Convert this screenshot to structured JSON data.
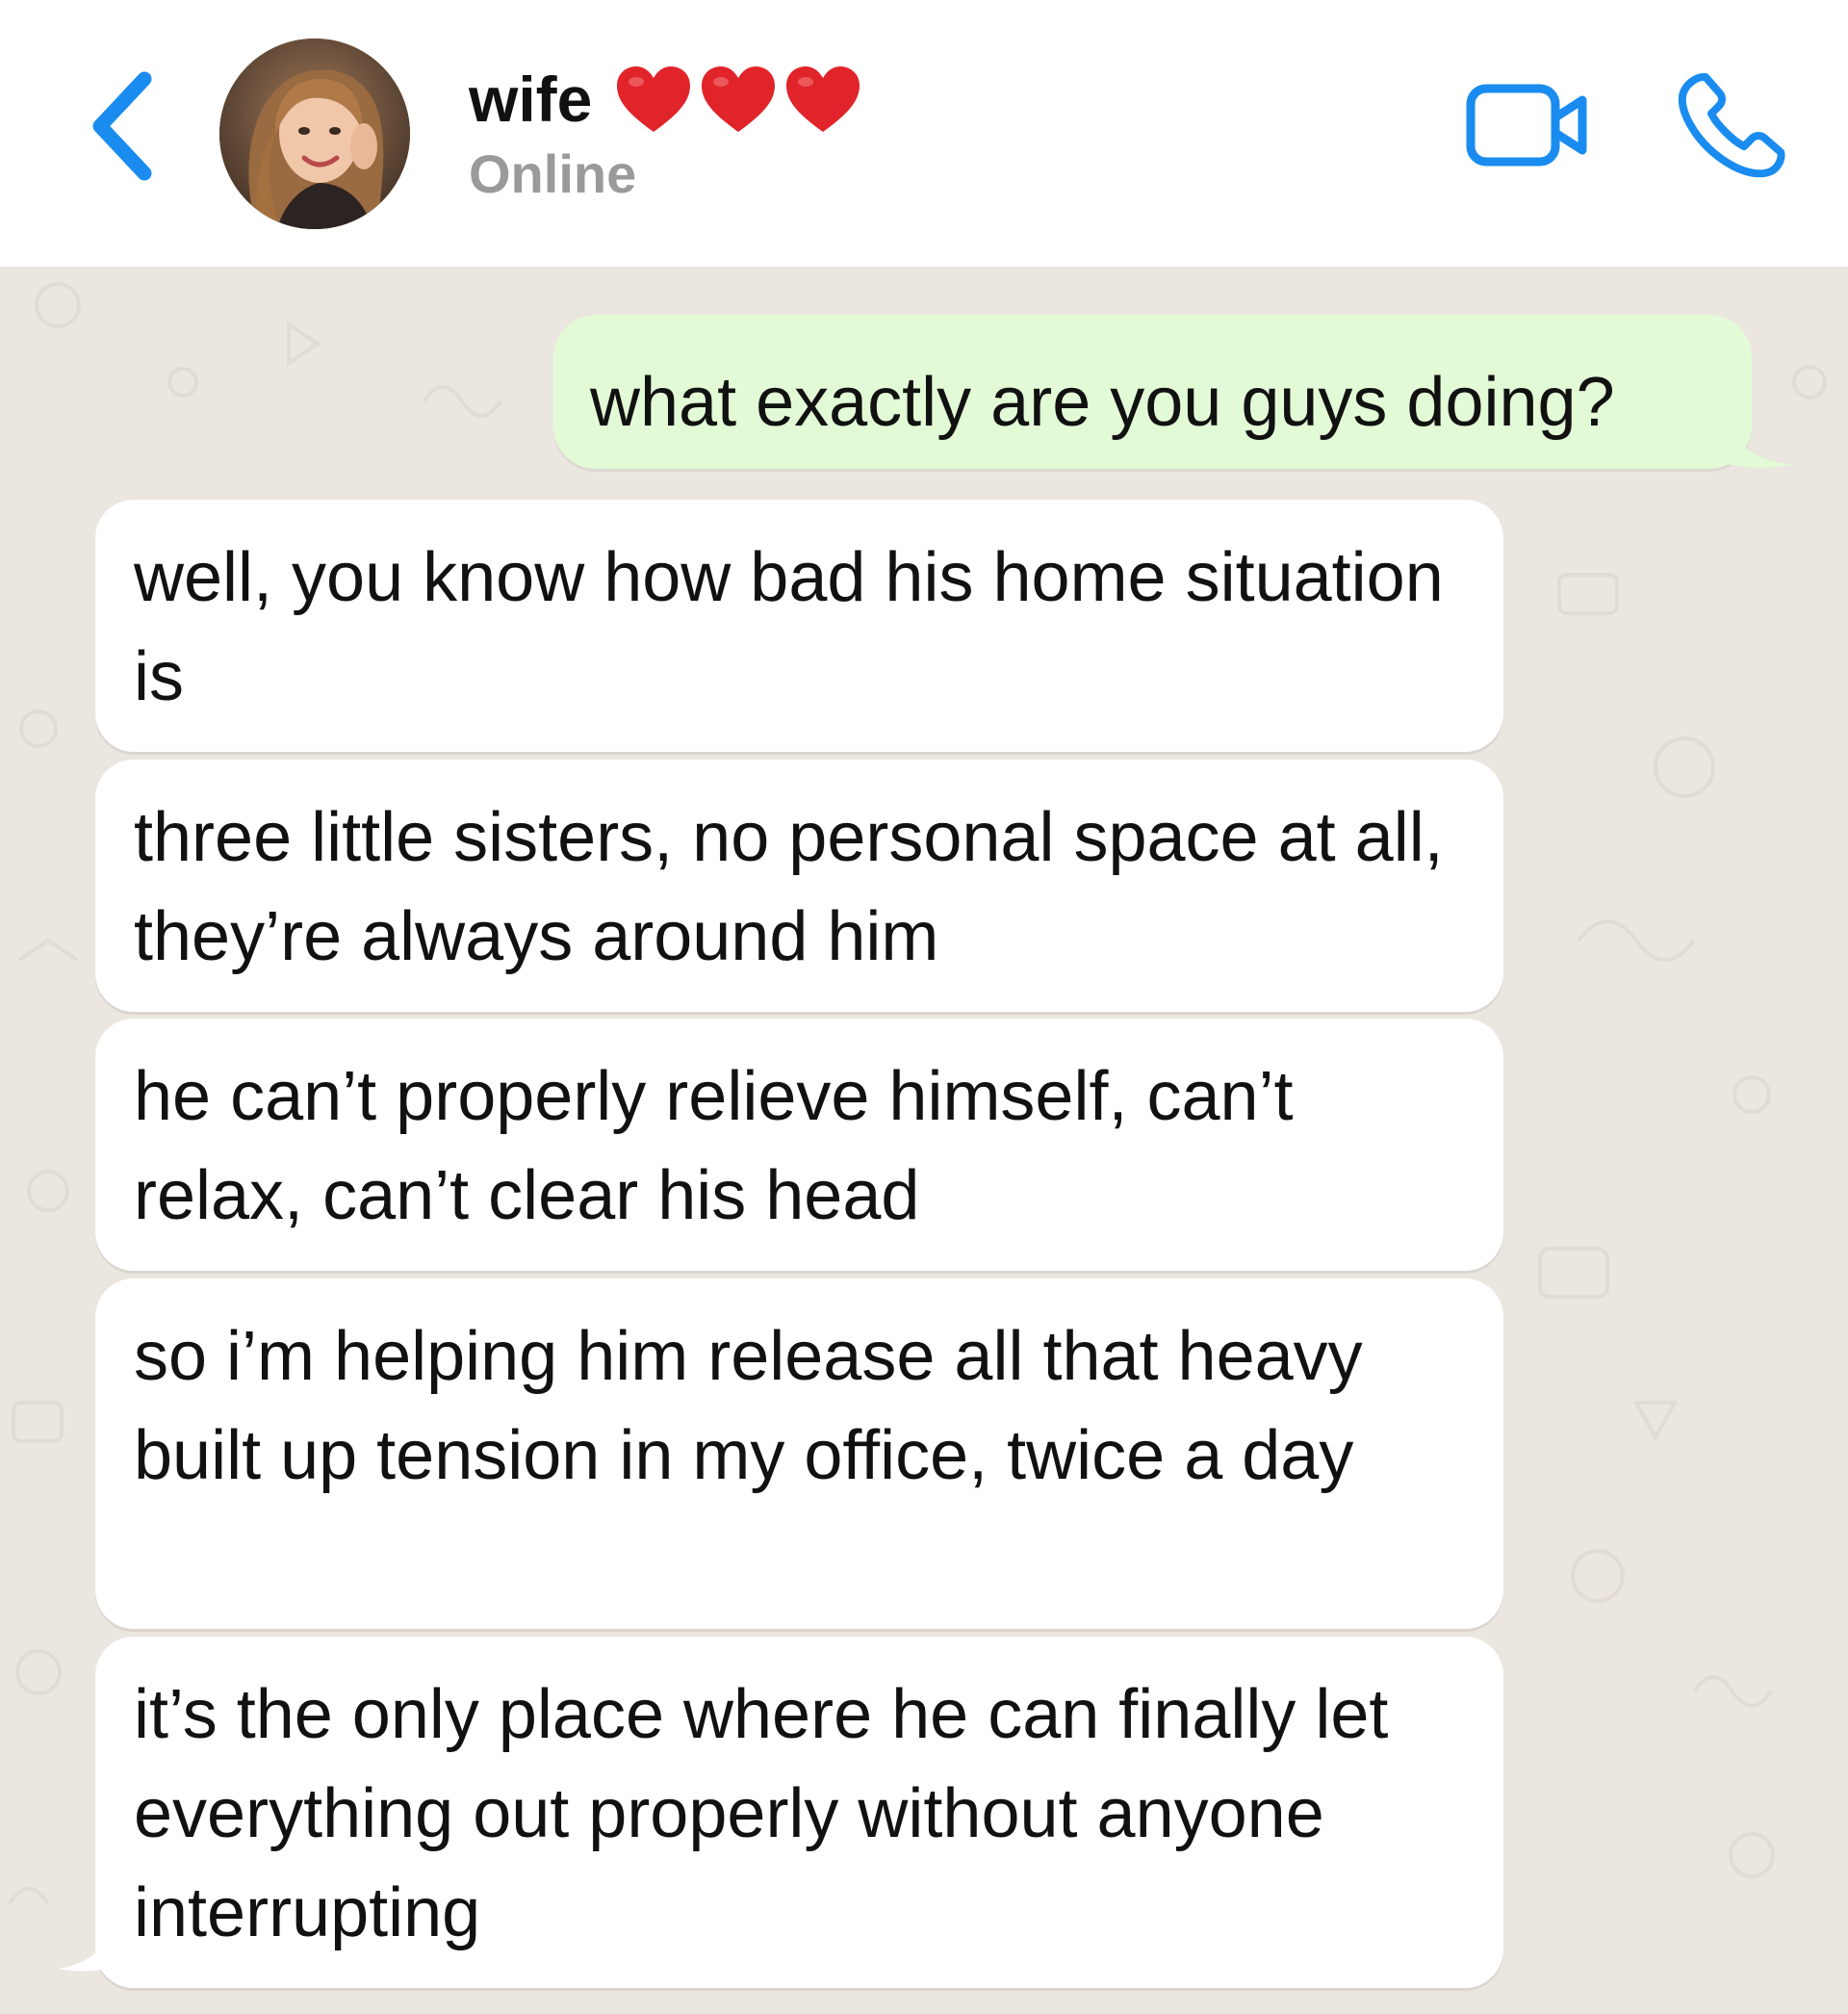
{
  "header": {
    "contact_name": "wife",
    "status": "Online",
    "hearts": [
      "heart-icon",
      "heart-icon",
      "heart-icon"
    ],
    "icons": {
      "back": "chevron-left-icon",
      "video": "video-camera-icon",
      "call": "phone-icon"
    }
  },
  "messages": [
    {
      "direction": "outgoing",
      "text": "what exactly are you guys doing?"
    },
    {
      "direction": "incoming",
      "text": "well, you know how bad his home situation is"
    },
    {
      "direction": "incoming",
      "text": "three little sisters, no personal space at all, they’re always around him"
    },
    {
      "direction": "incoming",
      "text": "he can’t properly relieve himself, can’t relax, can’t clear his head"
    },
    {
      "direction": "incoming",
      "text": "so i’m helping him release all that heavy built up tension in my office, twice a day"
    },
    {
      "direction": "incoming",
      "text": "it’s the only place where he can finally let everything out properly without anyone interrupting"
    }
  ],
  "colors": {
    "accent": "#1a8cf0",
    "header_bg": "#ffffff",
    "chat_bg": "#ebe6df",
    "outgoing_bubble": "#e2fbd6",
    "incoming_bubble": "#ffffff",
    "status_text": "#9a9a9a",
    "heart": "#e0242a"
  }
}
